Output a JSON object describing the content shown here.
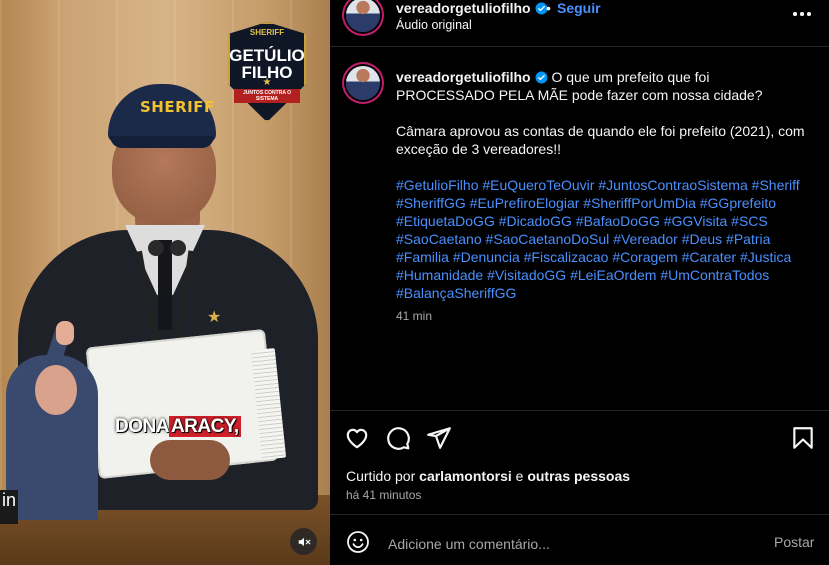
{
  "video": {
    "badge": {
      "top": "SHERIFF",
      "name_line1": "GETÚLIO",
      "name_line2": "FILHO",
      "ribbon": "JUNTOS CONTRA O SISTEMA"
    },
    "cap_text": "SHERIFF",
    "caption_prefix": "DONA",
    "caption_highlight": "ARACY,",
    "corner_text": "in",
    "mute_icon": "speaker-muted-icon"
  },
  "header": {
    "username": "vereadorgetuliofilho",
    "separator": "•",
    "follow_label": "Seguir",
    "audio_label": "Áudio original",
    "more_icon": "more-horizontal-icon"
  },
  "post": {
    "username": "vereadorgetuliofilho",
    "line1": "O que um prefeito que foi PROCESSADO PELA MÃE pode fazer com nossa cidade?",
    "line2": "Câmara aprovou as contas de quando ele foi prefeito (2021), com exceção de 3 vereadores!!",
    "hashtags": [
      "#GetulioFilho",
      "#EuQueroTeOuvir",
      "#JuntosContraoSistema",
      "#Sheriff",
      "#SheriffGG",
      "#EuPrefiroElogiar",
      "#SheriffPorUmDia",
      "#GGprefeito",
      "#EtiquetaDoGG",
      "#DicadoGG",
      "#BafaoDoGG",
      "#GGVisita",
      "#SCS",
      "#SaoCaetano",
      "#SaoCaetanoDoSul",
      "#Vereador",
      "#Deus",
      "#Patria",
      "#Familia",
      "#Denuncia",
      "#Fiscalizacao",
      "#Coragem",
      "#Carater",
      "#Justica",
      "#Humanidade",
      "#VisitadoGG",
      "#LeiEaOrdem",
      "#UmContraTodos",
      "#BalançaSheriffGG"
    ],
    "time": "41 min"
  },
  "actions": {
    "icons": [
      "heart-icon",
      "comment-icon",
      "share-icon",
      "bookmark-icon"
    ]
  },
  "likes": {
    "prefix": "Curtido por",
    "user": "carlamontorsi",
    "middle": "e",
    "others": "outras pessoas"
  },
  "ago": "há 41 minutos",
  "comment": {
    "emoji_icon": "emoji-icon",
    "placeholder": "Adicione um comentário...",
    "post_label": "Postar"
  },
  "colors": {
    "link": "#4a90ff",
    "muted": "#a8a8a8",
    "background": "#000000",
    "story_ring": "#c21f6b"
  }
}
